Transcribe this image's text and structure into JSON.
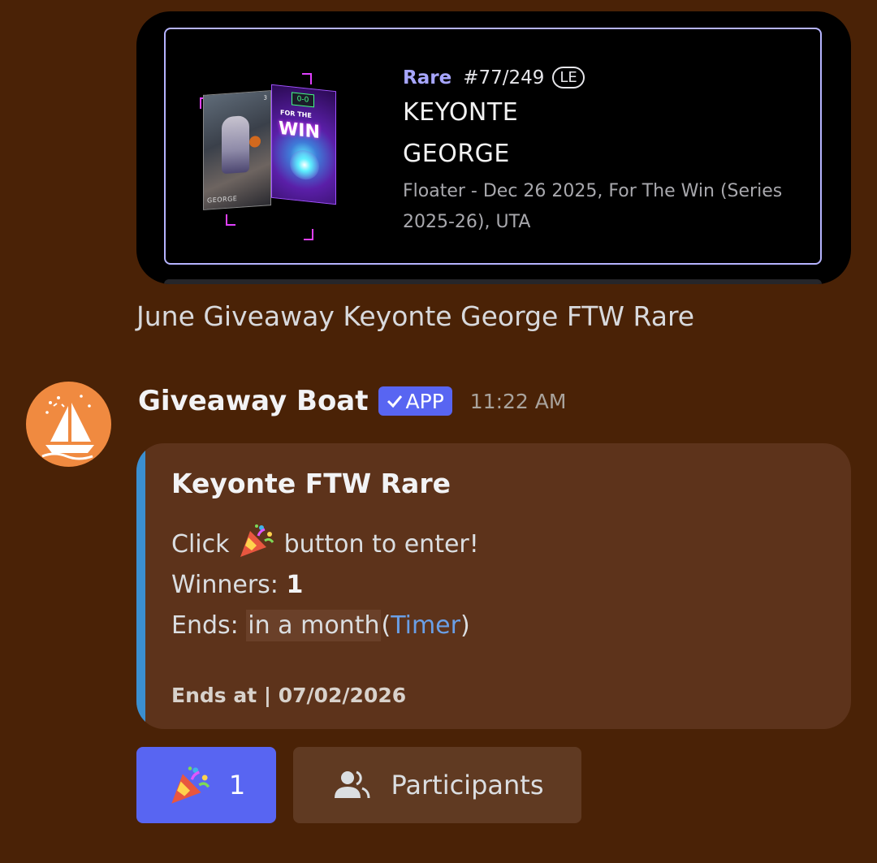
{
  "nft_card": {
    "rarity": "Rare",
    "serial": "#77/249",
    "badge": "LE",
    "first_name": "KEYONTE",
    "last_name": "GEORGE",
    "description": "Floater - Dec 26 2025, For The Win (Series 2025-26), UTA",
    "art_name": "GEORGE",
    "art_score": "0-0",
    "art_for_the": "FOR THE",
    "art_win": "WIN"
  },
  "caption": "June Giveaway Keyonte George FTW Rare",
  "message": {
    "username": "Giveaway Boat",
    "app_badge": "APP",
    "timestamp": "11:22 AM",
    "avatar_icon": "sailboat-confetti-icon",
    "avatar_color": "#f08a40"
  },
  "embed": {
    "accent_color": "#3b8fd0",
    "title": "Keyonte FTW Rare",
    "click_prefix": "Click",
    "click_suffix": "button to enter!",
    "winners_label": "Winners:",
    "winners_value": "1",
    "ends_label": "Ends:",
    "ends_value": "in a month",
    "timer_link": "Timer",
    "footer": "Ends at | 07/02/2026"
  },
  "buttons": {
    "enter_icon": "party-popper-icon",
    "enter_count": "1",
    "participants_icon": "users-icon",
    "participants_label": "Participants"
  },
  "colors": {
    "background": "#4a2206",
    "brand": "#5865f2",
    "link": "#6a9fe6"
  }
}
